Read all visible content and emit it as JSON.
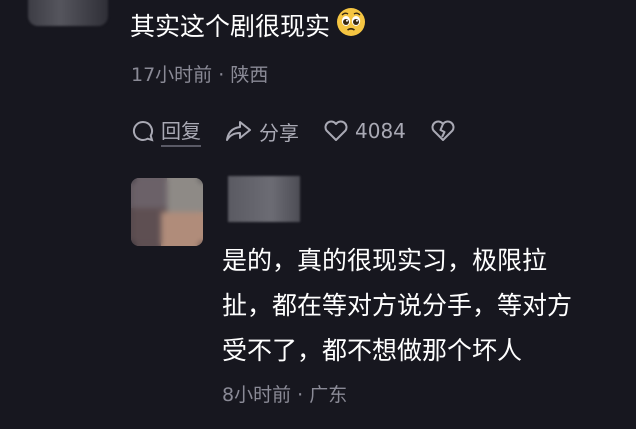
{
  "comment": {
    "text": "其实这个剧很现实",
    "emoji": "pleading-face-emoji",
    "time": "17小时前",
    "location": "陕西",
    "separator": "·"
  },
  "actions": {
    "reply_label": "回复",
    "share_label": "分享",
    "like_count": "4084"
  },
  "reply": {
    "text": "是的，真的很现实习，极限拉扯，都在等对方说分手，等对方受不了，都不想做那个坏人",
    "time": "8小时前",
    "location": "广东",
    "separator": "·"
  },
  "colors": {
    "background": "#17171f",
    "text_primary": "#ffffff",
    "text_meta": "#8a8a96",
    "action": "#a9a9b4"
  }
}
